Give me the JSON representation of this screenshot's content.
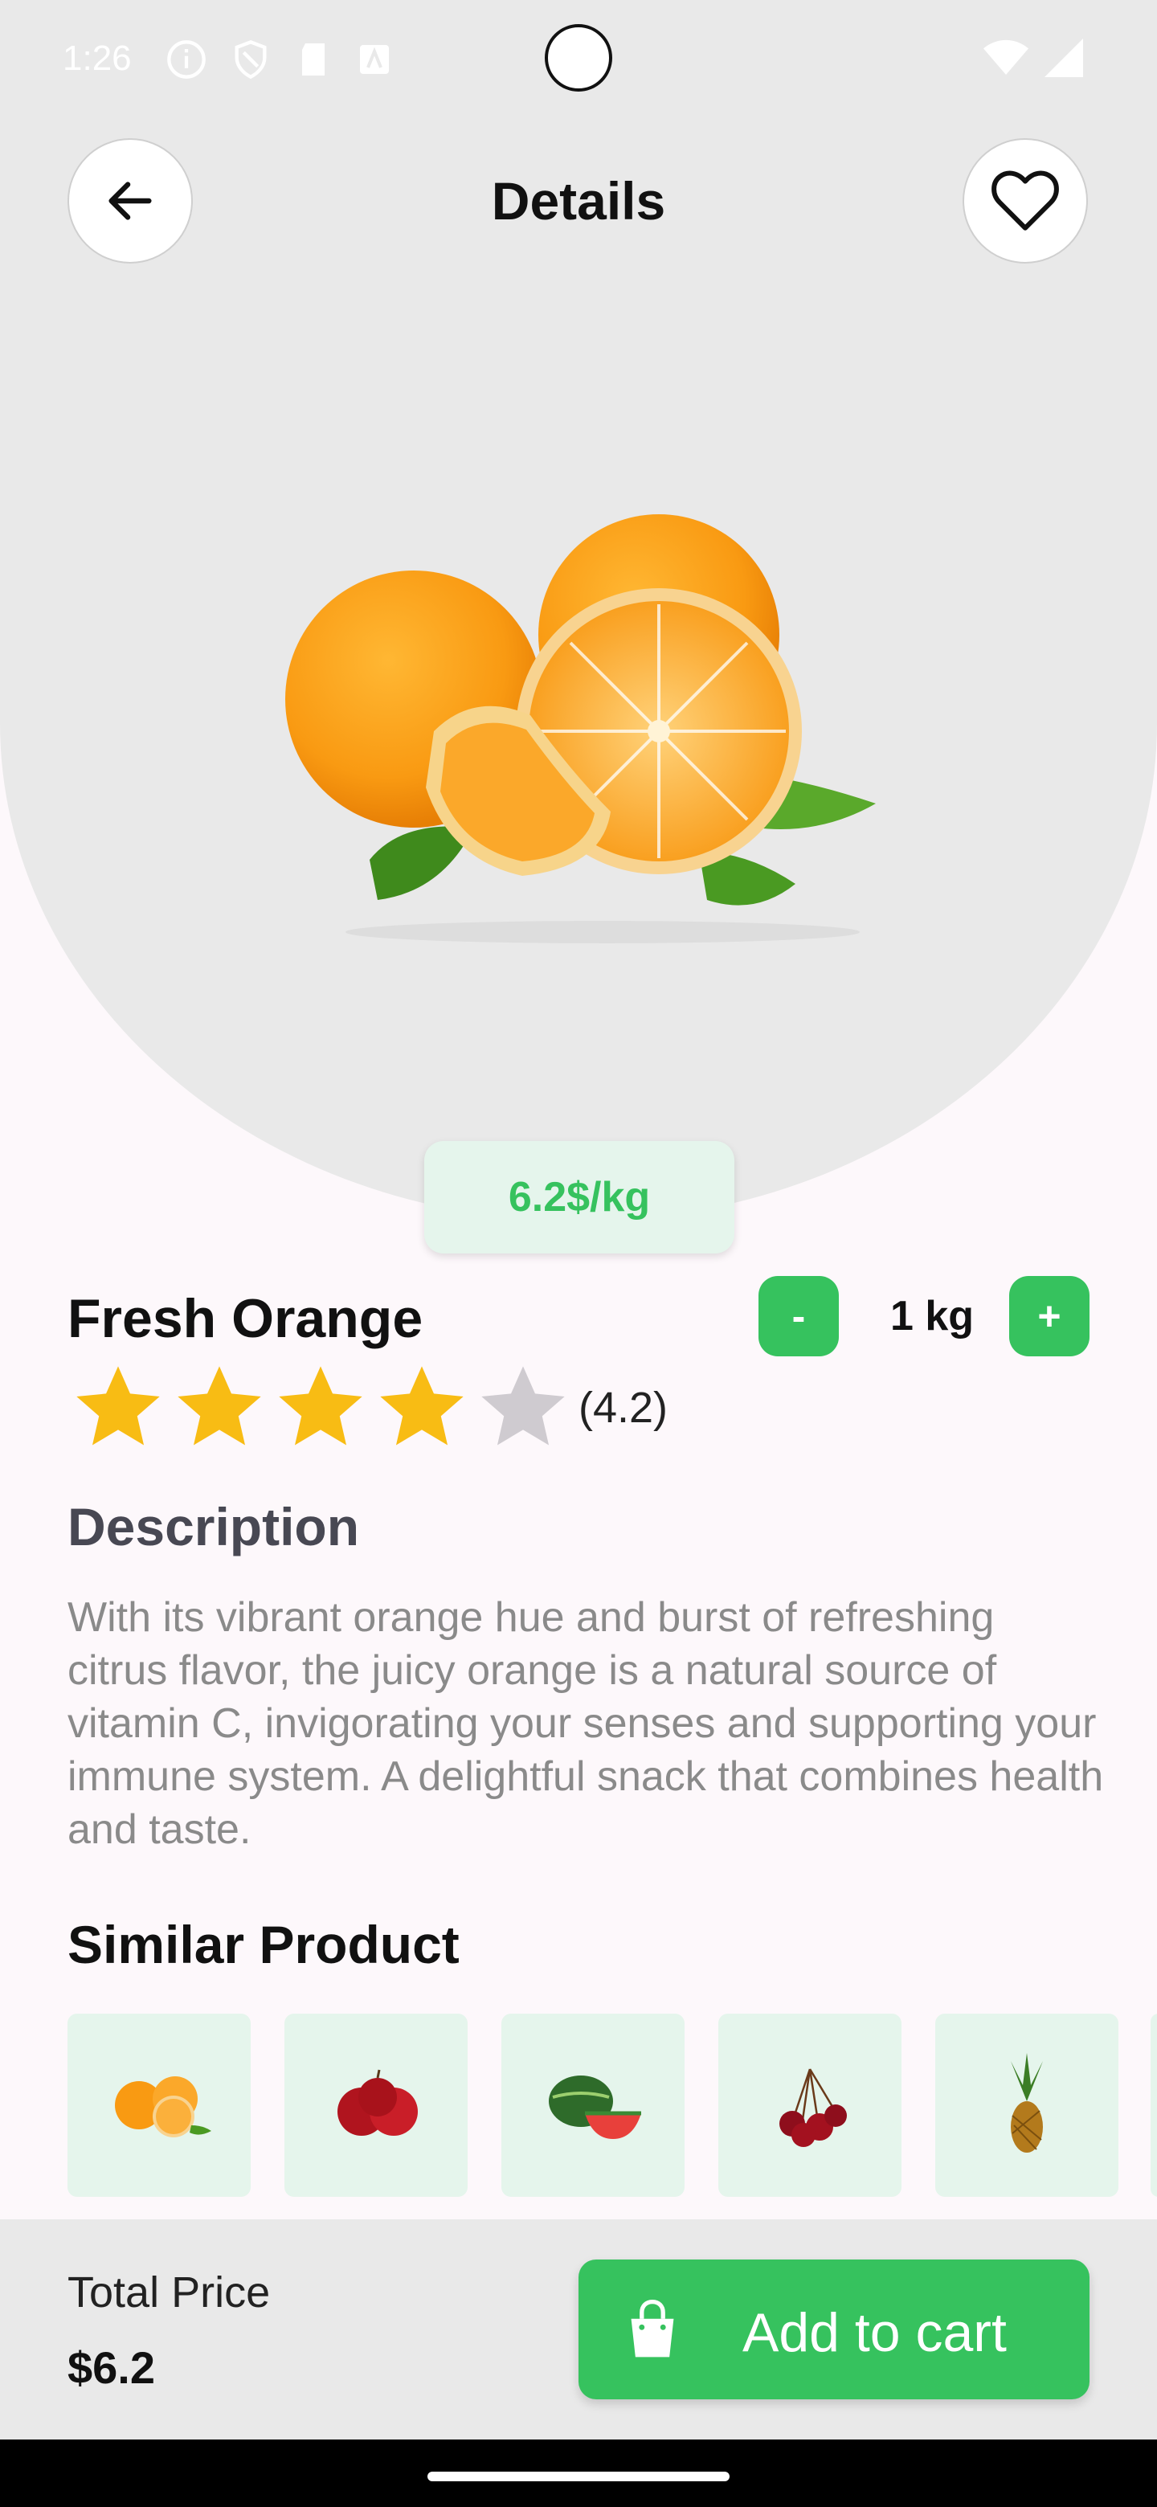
{
  "status": {
    "time": "1:26"
  },
  "header": {
    "title": "Details"
  },
  "product": {
    "price_tag": "6.2$/kg",
    "name": "Fresh Orange",
    "quantity": {
      "minus_label": "-",
      "value": "1 kg",
      "plus_label": "+"
    },
    "rating": {
      "value": 4.2,
      "max": 5,
      "text": "(4.2)"
    }
  },
  "description": {
    "title": "Description",
    "text": "With its vibrant orange hue and burst of refreshing citrus flavor, the juicy orange is a natural source of vitamin C, invigorating your senses and supporting your immune system. A delightful snack that combines health and taste."
  },
  "similar": {
    "title": "Similar Product",
    "items": [
      "orange-icon",
      "apple-icon",
      "watermelon-icon",
      "cherry-icon",
      "pineapple-icon"
    ]
  },
  "footer": {
    "total_label": "Total Price",
    "total_value": "$6.2",
    "add_to_cart_label": "Add to cart"
  },
  "colors": {
    "accent": "#36c25e",
    "chip_bg": "#e5f5ec",
    "hero_bg": "#e9e9e9",
    "star": "#f8bc14",
    "star_empty": "#cfcbd0"
  }
}
